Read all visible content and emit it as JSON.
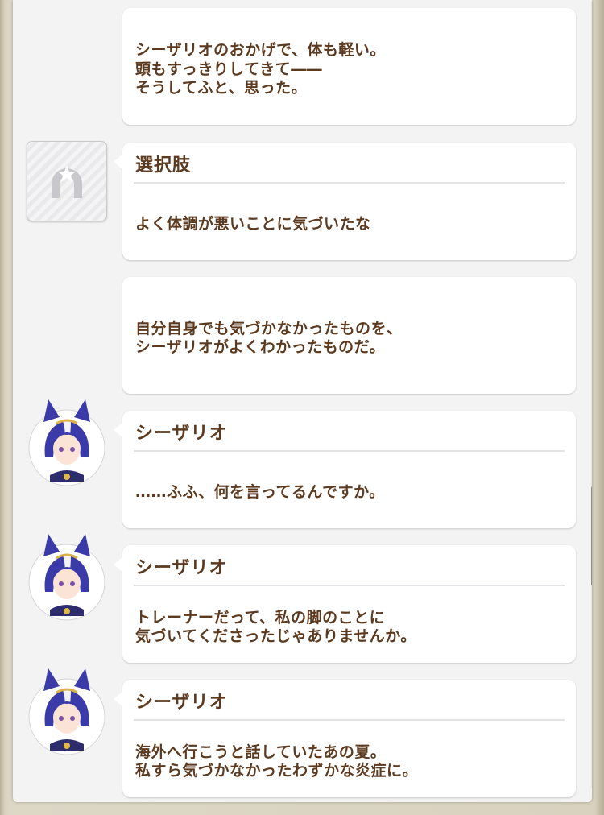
{
  "log": {
    "entries": [
      {
        "lines": [
          "シーザリオのおかげで、体も軽い。",
          "頭もすっきりしてきて――",
          "そうしてふと、思った。"
        ]
      },
      {
        "speaker": "選択肢",
        "lines": [
          "よく体調が悪いことに気づいたな"
        ]
      },
      {
        "lines": [
          "自分自身でも気づかなかったものを、",
          "シーザリオがよくわかったものだ。"
        ]
      },
      {
        "speaker": "シーザリオ",
        "lines": [
          "……ふふ、何を言ってるんですか。"
        ]
      },
      {
        "speaker": "シーザリオ",
        "lines": [
          "トレーナーだって、私の脚のことに",
          "気づいてくださったじゃありませんか。"
        ]
      },
      {
        "speaker": "シーザリオ",
        "lines": [
          "海外へ行こうと話していたあの夏。",
          "私すら気づかなかったわずかな炎症に。"
        ]
      }
    ]
  },
  "icons": {
    "choice": "horseshoe-star-icon",
    "avatar": "character-portrait-icon"
  },
  "colors": {
    "text": "#5b3a1f",
    "bubble": "#ffffff",
    "panel": "#f3f3f4",
    "hair": "#3a3aa8",
    "scroll_thumb": "#8b8b90"
  },
  "scroll": {
    "position_fraction": 0.62
  }
}
